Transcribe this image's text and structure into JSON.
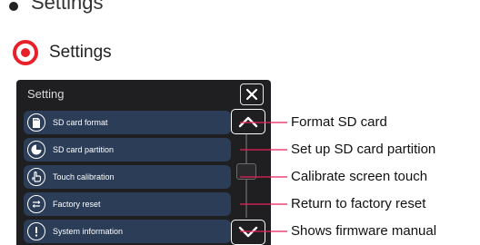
{
  "top_heading": "Settings",
  "section": {
    "title": "Settings",
    "icon": "target-icon",
    "accent_color": "#e8202a"
  },
  "device": {
    "title": "Setting",
    "close_icon": "close-icon",
    "menu_items": [
      {
        "label": "SD card format",
        "icon": "sd-card-icon"
      },
      {
        "label": "SD card partition",
        "icon": "partition-icon"
      },
      {
        "label": "Touch calibration",
        "icon": "touch-hand-icon"
      },
      {
        "label": "Factory reset",
        "icon": "reset-arrows-icon"
      },
      {
        "label": "System information",
        "icon": "info-icon"
      }
    ],
    "scroll_up_icon": "chevron-up-icon",
    "scroll_down_icon": "chevron-down-icon"
  },
  "callouts": [
    "Format SD card",
    "Set up SD card partition",
    "Calibrate screen touch",
    "Return to factory reset",
    "Shows firmware manual"
  ],
  "colors": {
    "menu_item_bg": "#2b3d57",
    "callout_line": "#e8205a",
    "panel_bg": "#1f1f21"
  }
}
